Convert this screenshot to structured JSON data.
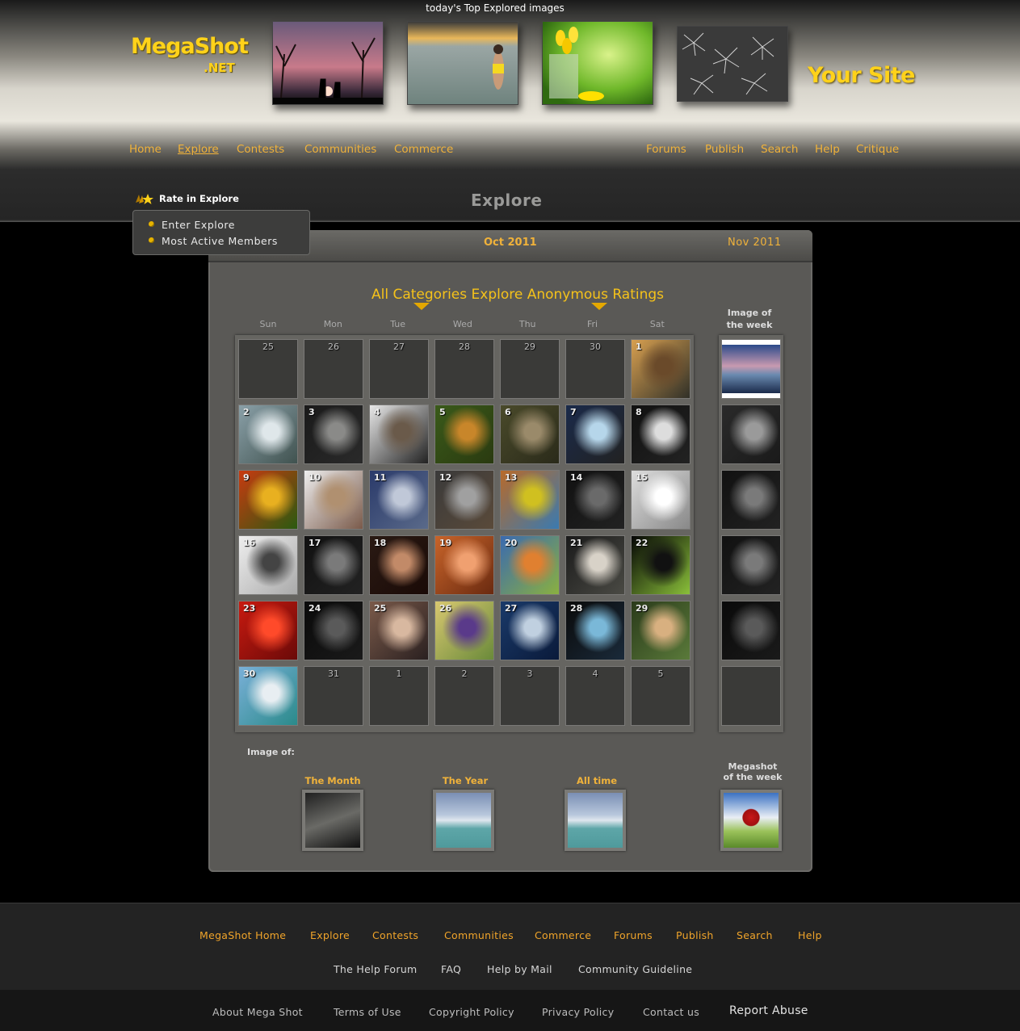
{
  "header": {
    "top_caption": "today's Top Explored images",
    "logo": "MegaShot",
    "logo_sub": ".NET",
    "your_site": "Your Site",
    "top_images": [
      "sunset-giraffes-photo",
      "beach-woman-photo",
      "tulips-photo",
      "dandelion-photo"
    ]
  },
  "nav": {
    "left": [
      "Home",
      "Explore",
      "Contests",
      "Communities",
      "Commerce"
    ],
    "right": [
      "Forums",
      "Publish",
      "Search",
      "Help",
      "Critique"
    ],
    "active": "Explore"
  },
  "rate_menu": {
    "title": "Rate in Explore",
    "items": [
      "Enter Explore",
      "Most Active Members"
    ]
  },
  "page_title": "Explore",
  "calendar": {
    "current_month": "Oct 2011",
    "next_month": "Nov 2011",
    "filter_title": "All Categories Explore Anonymous Ratings",
    "day_names": [
      "Sun",
      "Mon",
      "Tue",
      "Wed",
      "Thu",
      "Fri",
      "Sat"
    ],
    "image_of_week_title": [
      "Image of",
      "the week"
    ],
    "weeks": [
      [
        {
          "n": "25",
          "img": false
        },
        {
          "n": "26",
          "img": false
        },
        {
          "n": "27",
          "img": false
        },
        {
          "n": "28",
          "img": false
        },
        {
          "n": "29",
          "img": false
        },
        {
          "n": "30",
          "img": false
        },
        {
          "n": "1",
          "img": true
        }
      ],
      [
        {
          "n": "2",
          "img": true
        },
        {
          "n": "3",
          "img": true
        },
        {
          "n": "4",
          "img": true
        },
        {
          "n": "5",
          "img": true
        },
        {
          "n": "6",
          "img": true
        },
        {
          "n": "7",
          "img": true
        },
        {
          "n": "8",
          "img": true
        }
      ],
      [
        {
          "n": "9",
          "img": true
        },
        {
          "n": "10",
          "img": true
        },
        {
          "n": "11",
          "img": true
        },
        {
          "n": "12",
          "img": true
        },
        {
          "n": "13",
          "img": true
        },
        {
          "n": "14",
          "img": true
        },
        {
          "n": "15",
          "img": true
        }
      ],
      [
        {
          "n": "16",
          "img": true
        },
        {
          "n": "17",
          "img": true
        },
        {
          "n": "18",
          "img": true
        },
        {
          "n": "19",
          "img": true
        },
        {
          "n": "20",
          "img": true
        },
        {
          "n": "21",
          "img": true
        },
        {
          "n": "22",
          "img": true
        }
      ],
      [
        {
          "n": "23",
          "img": true
        },
        {
          "n": "24",
          "img": true
        },
        {
          "n": "25",
          "img": true
        },
        {
          "n": "26",
          "img": true
        },
        {
          "n": "27",
          "img": true
        },
        {
          "n": "28",
          "img": true
        },
        {
          "n": "29",
          "img": true
        }
      ],
      [
        {
          "n": "30",
          "img": true
        },
        {
          "n": "31",
          "img": false
        },
        {
          "n": "1",
          "img": false
        },
        {
          "n": "2",
          "img": false
        },
        {
          "n": "3",
          "img": false
        },
        {
          "n": "4",
          "img": false
        },
        {
          "n": "5",
          "img": false
        }
      ]
    ],
    "image_of_label": "Image of:",
    "bottom_labels": [
      "The Month",
      "The Year",
      "All time"
    ],
    "megashot_week": [
      "Megashot",
      "of the week"
    ]
  },
  "footer": {
    "row1": [
      "MegaShot Home",
      "Explore",
      "Contests",
      "Communities",
      "Commerce",
      "Forums",
      "Publish",
      "Search",
      "Help"
    ],
    "row2": [
      "The Help Forum",
      "FAQ",
      "Help by Mail",
      "Community Guideline"
    ],
    "row3": [
      "About Mega Shot",
      "Terms of Use",
      "Copyright Policy",
      "Privacy Policy",
      "Contact us",
      "Report Abuse"
    ]
  }
}
